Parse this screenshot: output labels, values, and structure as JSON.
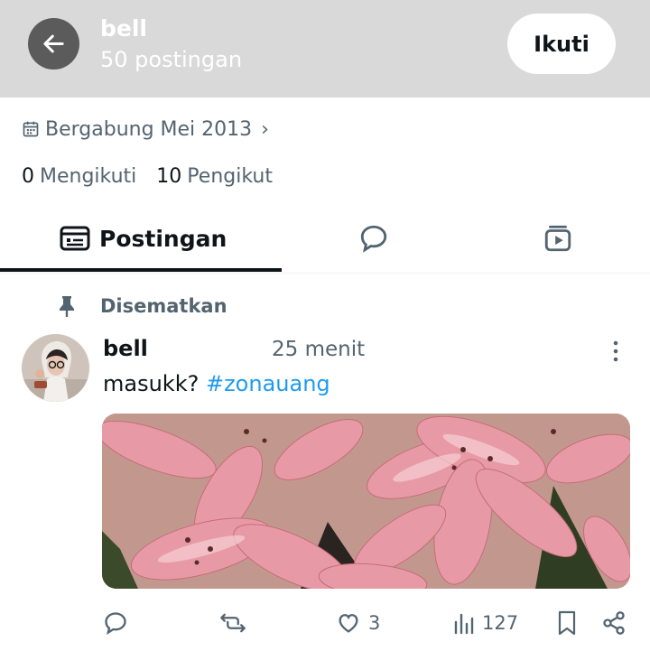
{
  "header": {
    "name": "bell",
    "post_count": "50 postingan",
    "follow_label": "Ikuti"
  },
  "profile": {
    "joined": "Bergabung Mei 2013",
    "following_count": "0",
    "following_label": "Mengikuti",
    "followers_count": "10",
    "followers_label": "Pengikut"
  },
  "tabs": {
    "posts_label": "Postingan"
  },
  "post": {
    "pinned_label": "Disematkan",
    "author": "bell",
    "time": "25 menit",
    "text": "masukk? ",
    "hashtag": "#zonauang",
    "like_count": "3",
    "view_count": "127"
  },
  "colors": {
    "accent": "#1d9bf0",
    "secondary_text": "#536471",
    "header_bg": "#d9d9d9"
  }
}
